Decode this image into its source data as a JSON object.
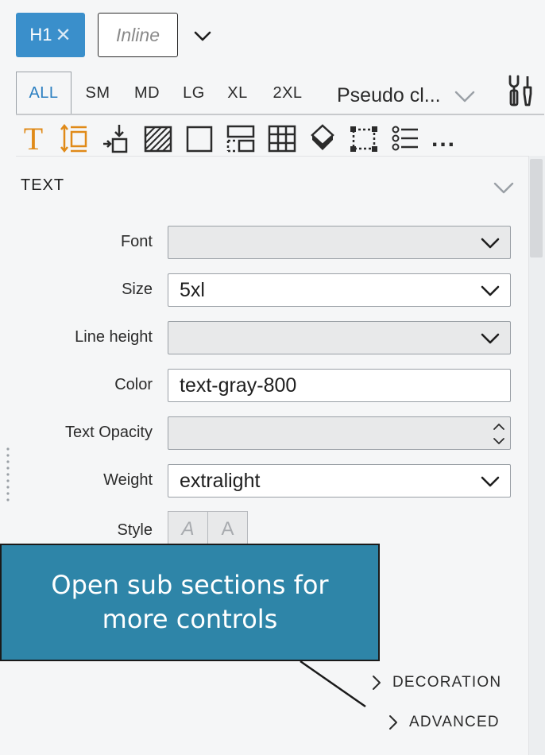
{
  "element": {
    "tag_label": "H1",
    "remove_icon": "close-icon",
    "inline_label": "Inline"
  },
  "breakpoints": [
    "ALL",
    "SM",
    "MD",
    "LG",
    "XL",
    "2XL"
  ],
  "active_breakpoint": "ALL",
  "pseudo_class": {
    "value": "Pseudo cl..."
  },
  "toolbar_icons": [
    "typography-icon",
    "spacing-icon",
    "position-icon",
    "background-icon",
    "border-icon",
    "layout-icon",
    "grid-icon",
    "effects-icon",
    "transform-icon",
    "list-icon",
    "more-icon"
  ],
  "more_label": "...",
  "section": {
    "title": "TEXT",
    "rows": {
      "font": {
        "label": "Font",
        "value": ""
      },
      "size": {
        "label": "Size",
        "value": "5xl"
      },
      "line_height": {
        "label": "Line height",
        "value": ""
      },
      "color": {
        "label": "Color",
        "value": "text-gray-800"
      },
      "text_opacity": {
        "label": "Text Opacity",
        "value": ""
      },
      "weight": {
        "label": "Weight",
        "value": "extralight"
      },
      "style": {
        "label": "Style",
        "italic": "A",
        "normal": "A"
      }
    }
  },
  "callout": {
    "text": "Open sub sections for more controls"
  },
  "sub_sections": {
    "decoration": "DECORATION",
    "advanced": "ADVANCED"
  },
  "colors": {
    "accent": "#3a8fcb",
    "tool_orange": "#e08a18",
    "callout_bg": "#2e85a8",
    "panel_bg": "#f5f6f7"
  }
}
